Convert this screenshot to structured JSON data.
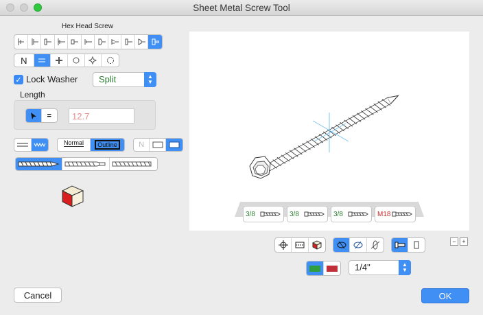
{
  "window": {
    "title": "Sheet Metal Screw Tool"
  },
  "head": {
    "label": "Hex Head Screw"
  },
  "drive": {
    "none_label": "N"
  },
  "lock_washer": {
    "label": "Lock Washer",
    "checked": true,
    "type": "Split"
  },
  "length": {
    "label": "Length",
    "value": "12.7"
  },
  "style": {
    "normal_label": "Normal",
    "outline_label": "Outline",
    "none_label": "N"
  },
  "thumbs": [
    {
      "size": "3/8",
      "color": "#2e7d32"
    },
    {
      "size": "3/8",
      "color": "#2e7d32"
    },
    {
      "size": "3/8",
      "color": "#2e7d32"
    },
    {
      "size": "M18",
      "color": "#c62828"
    }
  ],
  "size_select": {
    "value": "1/4\""
  },
  "zoom": {
    "minus": "−",
    "plus": "+"
  },
  "buttons": {
    "cancel": "Cancel",
    "ok": "OK"
  },
  "colors": {
    "accent": "#3f8ff5",
    "green_swatch": "#2e9e3e",
    "red_swatch": "#c0303a"
  }
}
